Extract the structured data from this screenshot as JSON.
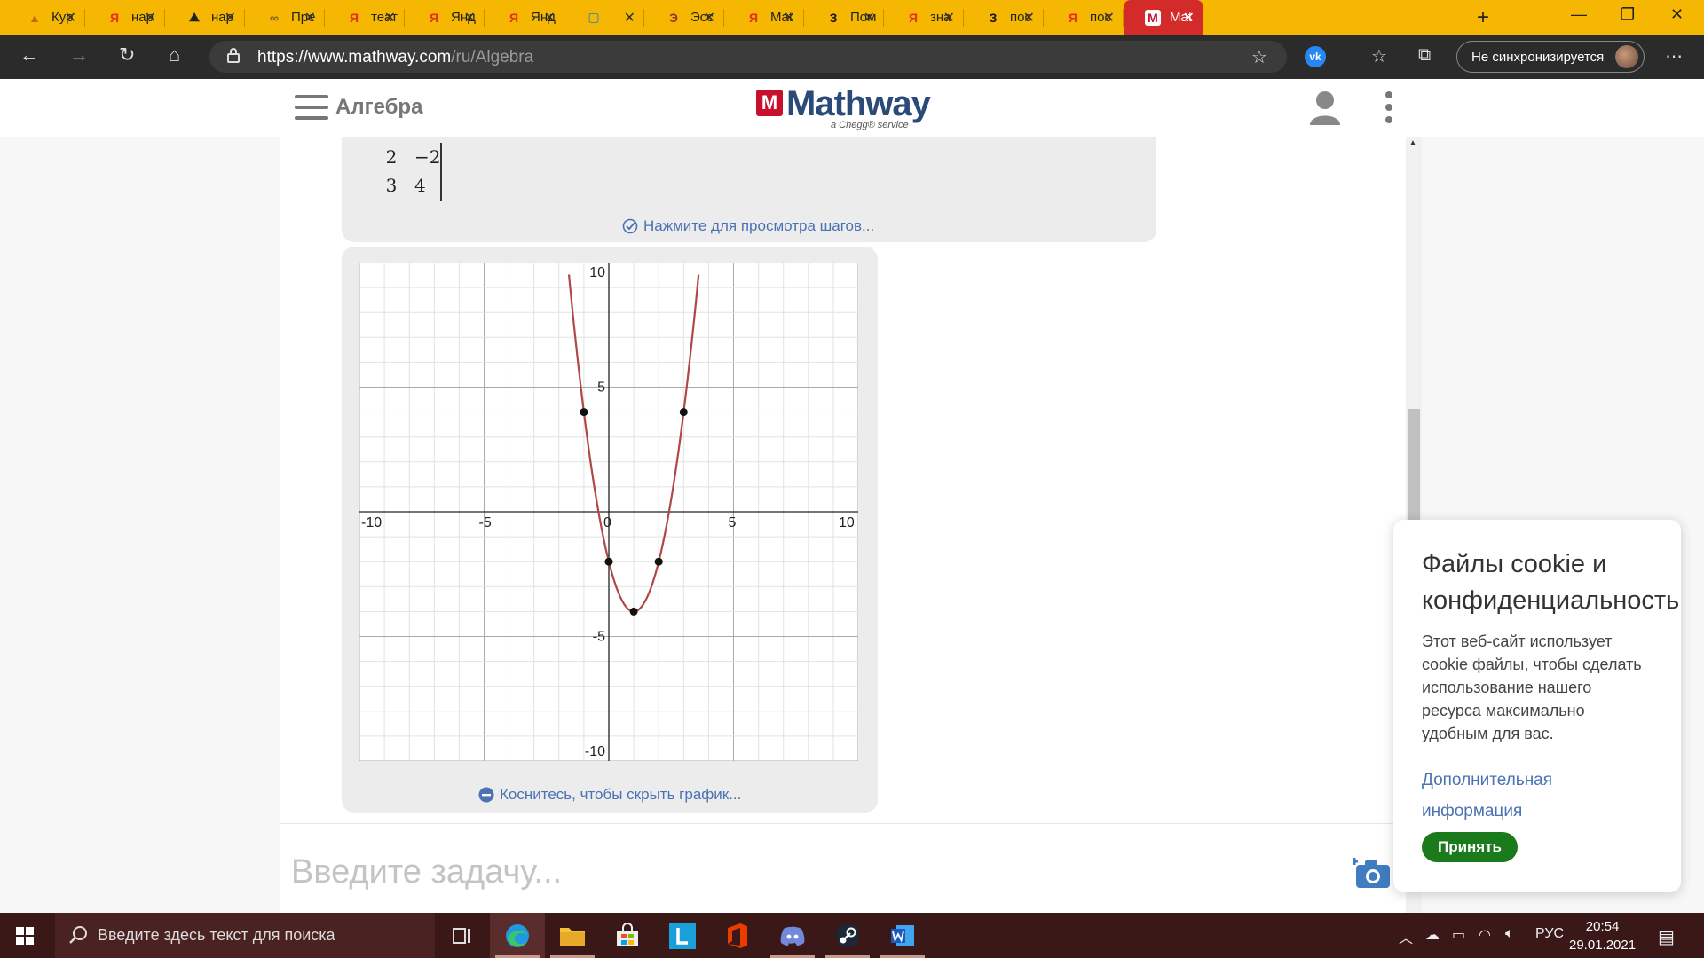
{
  "browser": {
    "tabs": [
      {
        "title": "Кур",
        "favicon": "graduation-cap-icon",
        "color": "#c86a00"
      },
      {
        "title": "нар",
        "favicon": "yandex-icon",
        "color": "#e62d1e"
      },
      {
        "title": "нар",
        "favicon": "mountains-icon",
        "color": "#222222"
      },
      {
        "title": "Пре",
        "favicon": "link-chain-icon",
        "color": "#7a5f2a"
      },
      {
        "title": "теат",
        "favicon": "yandex-icon",
        "color": "#e62d1e"
      },
      {
        "title": "Янд",
        "favicon": "yandex-browser-icon",
        "color": "#e62d1e"
      },
      {
        "title": "Янд",
        "favicon": "yandex-browser-icon",
        "color": "#e62d1e"
      },
      {
        "title": "",
        "favicon": "chat-bubble-icon",
        "color": "#1e7bd8"
      },
      {
        "title": "Эсс",
        "favicon": "essay-icon",
        "color": "#a03030"
      },
      {
        "title": "Mat",
        "favicon": "yandex-icon",
        "color": "#e62d1e"
      },
      {
        "title": "Пом",
        "favicon": "znanija-icon",
        "color": "#111111"
      },
      {
        "title": "зна",
        "favicon": "yandex-icon",
        "color": "#e62d1e"
      },
      {
        "title": "пос",
        "favicon": "znanija-icon",
        "color": "#111111"
      },
      {
        "title": "пос",
        "favicon": "yandex-icon",
        "color": "#e62d1e"
      },
      {
        "title": "Mat",
        "favicon": "mathway-icon",
        "color": "#c8102e"
      }
    ],
    "url_main": "https://www.mathway.com",
    "url_path": "/ru/Algebra",
    "sync_label": "Не синхронизируется"
  },
  "header": {
    "section_title": "Алгебра",
    "logo_mark": "M",
    "logo_word": "Mathway",
    "logo_sub": "a Chegg® service"
  },
  "value_table": {
    "rows": [
      {
        "x": "2",
        "y": "−2"
      },
      {
        "x": "3",
        "y": "4"
      }
    ]
  },
  "links": {
    "steps": "Нажмите для просмотра шагов...",
    "hide_graph": "Коснитесь, чтобы скрыть график..."
  },
  "chart_data": {
    "type": "line",
    "title": "",
    "xlabel": "",
    "ylabel": "",
    "xlim": [
      -10,
      10
    ],
    "ylim": [
      -10,
      10
    ],
    "grid": true,
    "x_ticks": [
      "-10",
      "-5",
      "0",
      "5",
      "10"
    ],
    "y_ticks": [
      "10",
      "5",
      "-5",
      "-10"
    ],
    "series": [
      {
        "function": "y = 2x^2 - 4x - 2",
        "color": "#b04848",
        "x_range": [
          -1.6,
          3.6
        ]
      }
    ],
    "points": [
      {
        "x": -1,
        "y": 4
      },
      {
        "x": 0,
        "y": -2
      },
      {
        "x": 1,
        "y": -4
      },
      {
        "x": 2,
        "y": -2
      },
      {
        "x": 3,
        "y": 4
      }
    ]
  },
  "input": {
    "placeholder": "Введите задачу..."
  },
  "cookie": {
    "title": "Файлы cookie и конфиденциальность",
    "body": "Этот веб-сайт использует cookie файлы, чтобы сделать использование нашего ресурса максимально удобным для вас.",
    "more": "Дополнительная информация",
    "accept": "Принять"
  },
  "taskbar": {
    "search_placeholder": "Введите здесь текст для поиска",
    "lang": "РУС",
    "time": "20:54",
    "date": "29.01.2021"
  }
}
